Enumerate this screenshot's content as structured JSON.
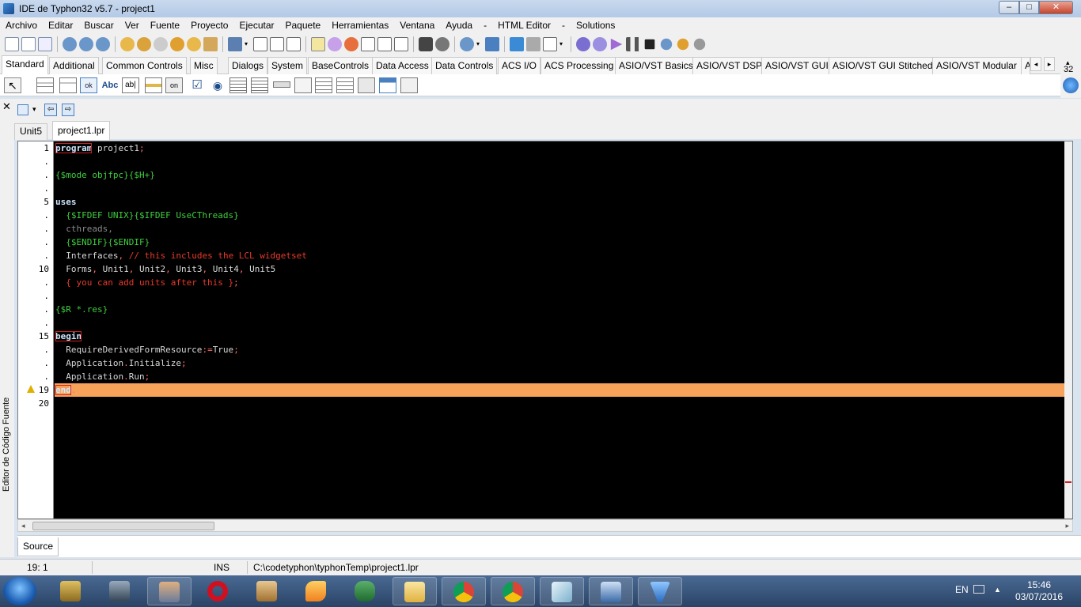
{
  "window": {
    "title": "IDE de Typhon32 v5.7 - project1",
    "controls": {
      "minimize": "–",
      "maximize": "□",
      "close": "✕"
    }
  },
  "menu": [
    "Archivo",
    "Editar",
    "Buscar",
    "Ver",
    "Fuente",
    "Proyecto",
    "Ejecutar",
    "Paquete",
    "Herramientas",
    "Ventana",
    "Ayuda",
    "-",
    "HTML Editor",
    "-",
    "Solutions"
  ],
  "palette_tabs": [
    "Standard",
    "Additional",
    "Common Controls",
    "Misc",
    "Dialogs",
    "System",
    "BaseControls",
    "Data Access",
    "Data Controls",
    "ACS I/O",
    "ACS Processing",
    "ASIO/VST Basics",
    "ASIO/VST DSP",
    "ASIO/VST GUI",
    "ASIO/VST GUI Stitched",
    "ASIO/VST Modular",
    "A"
  ],
  "palette_side": {
    "size": "32"
  },
  "palette_components": [
    "selector-arrow-icon",
    "main-menu-icon",
    "popup-menu-icon",
    "button-icon",
    "label-icon",
    "edit-icon",
    "memo-icon",
    "toggle-box-icon",
    "checkbox-icon",
    "radio-button-icon",
    "listbox-icon",
    "combobox-icon",
    "scrollbar-icon",
    "groupbox-icon",
    "radiogroup-icon",
    "checkgroup-icon",
    "panel-icon",
    "frame-icon",
    "actionlist-icon"
  ],
  "palette_labels": {
    "button": "ok",
    "label": "Abc",
    "edit": "ab|",
    "toggle": "on"
  },
  "editor_side_label": "Editor de Código Fuente",
  "doc_tabs": [
    "Unit5",
    "project1.lpr"
  ],
  "gutter": [
    "1",
    ".",
    ".",
    ".",
    "5",
    ".",
    ".",
    ".",
    ".",
    "10",
    ".",
    ".",
    ".",
    ".",
    "15",
    ".",
    ".",
    ".",
    "19",
    "20"
  ],
  "code_lines": [
    "program project1;",
    "",
    "{$mode objfpc}{$H+}",
    "",
    "uses",
    "  {$IFDEF UNIX}{$IFDEF UseCThreads}",
    "  cthreads,",
    "  {$ENDIF}{$ENDIF}",
    "  Interfaces, // this includes the LCL widgetset",
    "  Forms, Unit1, Unit2, Unit3, Unit4, Unit5",
    "  { you can add units after this };",
    "",
    "{$R *.res}",
    "",
    "begin",
    "  RequireDerivedFormResource:=True;",
    "  Application.Initialize;",
    "  Application.Run;",
    "end.",
    ""
  ],
  "highlight_color": "#f7a25a",
  "source_tab": "Source",
  "status": {
    "position": "19:  1",
    "mode": "INS",
    "file": "C:\\codetyphon\\typhonTemp\\project1.lpr"
  },
  "taskbar": {
    "apps": [
      "explorer-archive-icon",
      "network-icon",
      "typhon-ide-icon",
      "opera-icon",
      "installer-icon",
      "fox-icon",
      "elephant-icon",
      "folder-icon",
      "chrome-icon",
      "chrome-icon",
      "notepad-icon",
      "remote-desktop-icon",
      "tornado-icon"
    ],
    "language": "EN",
    "time": "15:46",
    "date": "03/07/2016"
  }
}
